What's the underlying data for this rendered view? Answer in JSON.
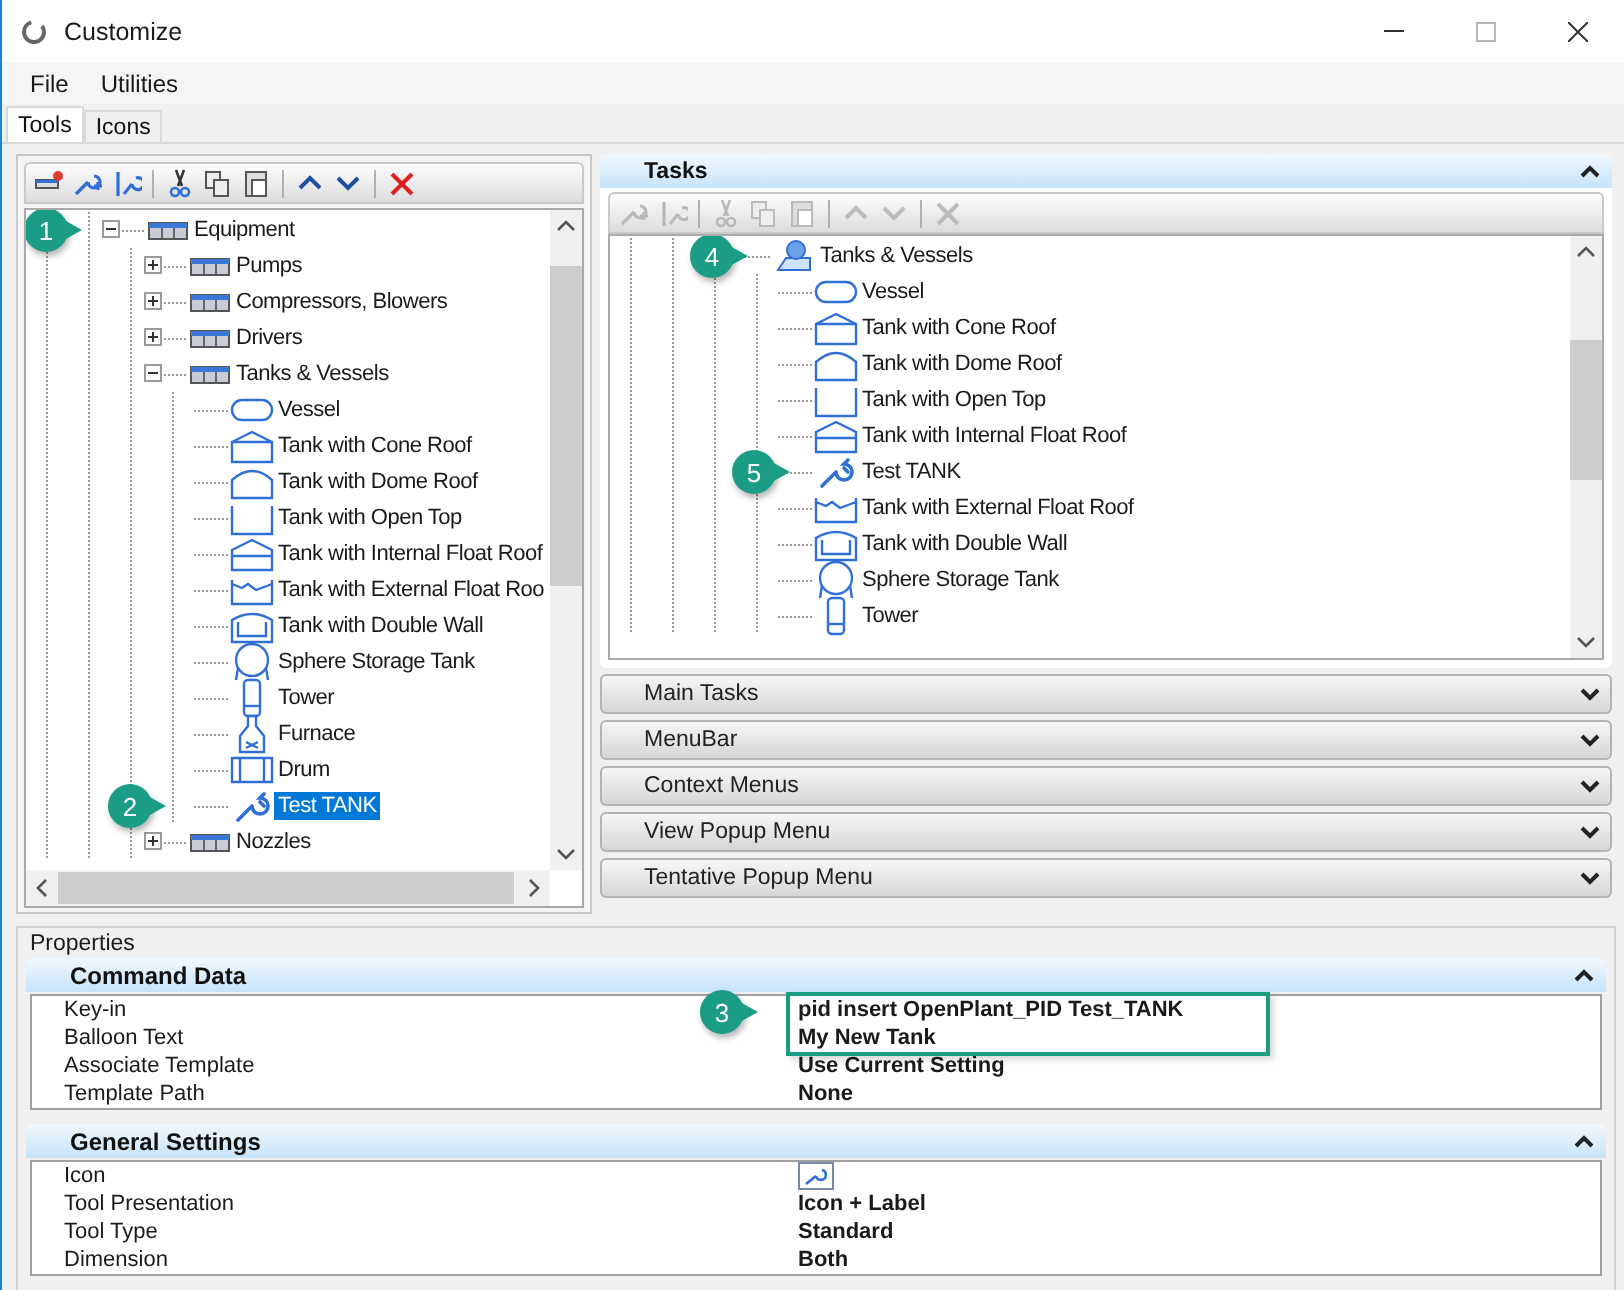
{
  "window": {
    "title": "Customize"
  },
  "menu": [
    "File",
    "Utilities"
  ],
  "tabs": [
    {
      "label": "Tools",
      "selected": true
    },
    {
      "label": "Icons",
      "selected": false
    }
  ],
  "tool_tree": {
    "toolbar": {
      "disabled": false,
      "tools": [
        {
          "kind": "add-bar"
        },
        {
          "kind": "add-tool"
        },
        {
          "kind": "edit-tool"
        },
        {
          "kind": "sep"
        },
        {
          "kind": "cut"
        },
        {
          "kind": "copy"
        },
        {
          "kind": "paste"
        },
        {
          "kind": "sep"
        },
        {
          "kind": "up"
        },
        {
          "kind": "down"
        },
        {
          "kind": "sep"
        },
        {
          "kind": "delete"
        }
      ]
    },
    "items": [
      {
        "label": "Equipment",
        "kind": "group",
        "expanded": true,
        "selected": false,
        "callout": "1",
        "children": [
          {
            "label": "Pumps",
            "kind": "group",
            "expanded": false,
            "selected": false
          },
          {
            "label": "Compressors, Blowers",
            "kind": "group",
            "expanded": false,
            "selected": false
          },
          {
            "label": "Drivers",
            "kind": "group",
            "expanded": false,
            "selected": false
          },
          {
            "label": "Tanks & Vessels",
            "kind": "group",
            "expanded": true,
            "selected": false,
            "children": [
              {
                "label": "Vessel",
                "kind": "vessel",
                "selected": false
              },
              {
                "label": "Tank with Cone Roof",
                "kind": "cone-roof",
                "selected": false
              },
              {
                "label": "Tank with Dome Roof",
                "kind": "dome-roof",
                "selected": false
              },
              {
                "label": "Tank with Open Top",
                "kind": "open-top",
                "selected": false
              },
              {
                "label": "Tank with Internal Float Roof",
                "kind": "internal-float",
                "selected": false
              },
              {
                "label": "Tank with External Float Roo",
                "kind": "external-float",
                "selected": false
              },
              {
                "label": "Tank with Double Wall",
                "kind": "double-wall",
                "selected": false
              },
              {
                "label": "Sphere Storage Tank",
                "kind": "sphere",
                "selected": false
              },
              {
                "label": "Tower",
                "kind": "tower",
                "selected": false
              },
              {
                "label": "Furnace",
                "kind": "furnace",
                "selected": false
              },
              {
                "label": "Drum",
                "kind": "drum",
                "selected": false
              },
              {
                "label": "Test TANK",
                "kind": "tool",
                "selected": true,
                "callout": "2"
              }
            ]
          },
          {
            "label": "Nozzles",
            "kind": "group",
            "expanded": false,
            "selected": false
          }
        ]
      }
    ]
  },
  "tasks_panel": {
    "title": "Tasks",
    "expanded": true,
    "toolbar": {
      "disabled": true,
      "tools": [
        {
          "kind": "add-tool"
        },
        {
          "kind": "edit-tool"
        },
        {
          "kind": "sep"
        },
        {
          "kind": "cut"
        },
        {
          "kind": "copy"
        },
        {
          "kind": "paste"
        },
        {
          "kind": "sep"
        },
        {
          "kind": "up"
        },
        {
          "kind": "down"
        },
        {
          "kind": "sep"
        },
        {
          "kind": "delete"
        }
      ]
    },
    "items": [
      {
        "label": "Tanks & Vessels",
        "kind": "task-group",
        "selected": false,
        "callout": "4",
        "children": [
          {
            "label": "Vessel",
            "kind": "vessel",
            "selected": false
          },
          {
            "label": "Tank with Cone Roof",
            "kind": "cone-roof",
            "selected": false
          },
          {
            "label": "Tank with Dome Roof",
            "kind": "dome-roof",
            "selected": false
          },
          {
            "label": "Tank with Open Top",
            "kind": "open-top",
            "selected": false
          },
          {
            "label": "Tank with Internal Float Roof",
            "kind": "internal-float",
            "selected": false
          },
          {
            "label": "Test TANK",
            "kind": "tool",
            "selected": false,
            "callout": "5"
          },
          {
            "label": "Tank with External Float Roof",
            "kind": "external-float",
            "selected": false
          },
          {
            "label": "Tank with Double Wall",
            "kind": "double-wall",
            "selected": false
          },
          {
            "label": "Sphere Storage Tank",
            "kind": "sphere",
            "selected": false
          },
          {
            "label": "Tower",
            "kind": "tower",
            "selected": false
          }
        ]
      }
    ]
  },
  "sections": [
    {
      "title": "Main Tasks",
      "expanded": false
    },
    {
      "title": "MenuBar",
      "expanded": false
    },
    {
      "title": "Context Menus",
      "expanded": false
    },
    {
      "title": "View Popup Menu",
      "expanded": false
    },
    {
      "title": "Tentative Popup Menu",
      "expanded": false
    }
  ],
  "properties": {
    "title": "Properties",
    "groups": [
      {
        "title": "Command Data",
        "expanded": true,
        "rows": [
          {
            "label": "Key-in",
            "kind": "text",
            "value": "pid insert OpenPlant_PID Test_TANK",
            "highlighted": true,
            "callout": "3"
          },
          {
            "label": "Balloon Text",
            "kind": "text",
            "value": "My New Tank",
            "highlighted": true
          },
          {
            "label": "Associate Template",
            "kind": "text",
            "value": "Use Current Setting",
            "highlighted": false
          },
          {
            "label": "Template Path",
            "kind": "text",
            "value": "None",
            "highlighted": false
          }
        ]
      },
      {
        "title": "General Settings",
        "expanded": true,
        "rows": [
          {
            "label": "Icon",
            "kind": "icon",
            "highlighted": false
          },
          {
            "label": "Tool Presentation",
            "kind": "text",
            "value": "Icon + Label",
            "highlighted": false
          },
          {
            "label": "Tool Type",
            "kind": "text",
            "value": "Standard",
            "highlighted": false
          },
          {
            "label": "Dimension",
            "kind": "text",
            "value": "Both",
            "highlighted": false
          }
        ]
      }
    ]
  }
}
